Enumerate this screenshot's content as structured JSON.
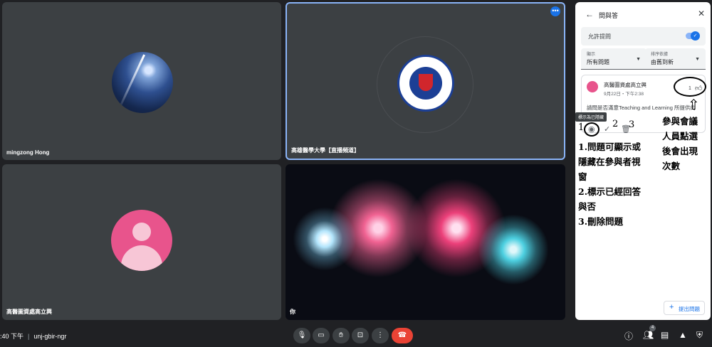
{
  "tiles": {
    "tile1_name": "mingzong Hong",
    "tile2_name": "高雄醫學大學【直播頻道】",
    "tile3_name": "高醫圖資處高立興",
    "tile4_name": "你"
  },
  "panel": {
    "title": "問與答",
    "allow_label": "允許提問",
    "filter_label": "顯示",
    "filter_value": "所有問題",
    "sort_label": "排序依據",
    "sort_value": "由舊到新",
    "question": {
      "author": "高醫圖資處高立興",
      "time": "9月22日・下午2:38",
      "upvotes": "1",
      "text": "請問是否滿意Teaching and Learning 所提供的功能?"
    },
    "tooltip": "標示為已隱藏",
    "ask_button": "提出問題"
  },
  "annotations": {
    "num1": "1",
    "num2": "2",
    "num3": "3",
    "left_lines": [
      "1.問題可顯示或",
      "隱藏在參與者視",
      "窗",
      "2.標示已經回答",
      "與否",
      "3.刪除問題"
    ],
    "right_lines": [
      "參與會議",
      "人員點選",
      "後會出現",
      "次數"
    ]
  },
  "bottom_bar": {
    "time": ":40 下午",
    "meeting_code": "unj-gbir-ngr",
    "people_count": "4"
  },
  "colors": {
    "accent": "#1a73e8",
    "end_call": "#ea4335",
    "tile_bg": "#3c4043",
    "avatar_pink": "#e8548c"
  }
}
